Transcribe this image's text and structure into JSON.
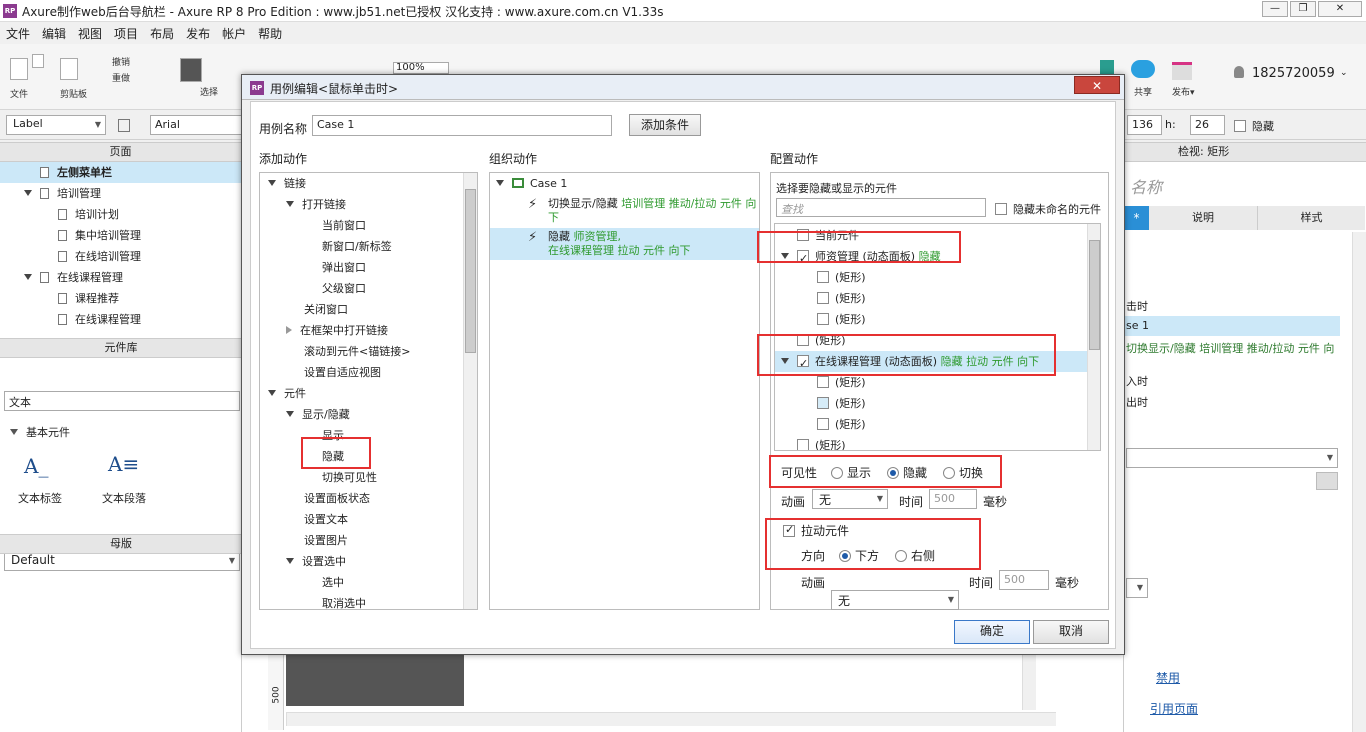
{
  "window": {
    "title": "Axure制作web后台导航栏 - Axure RP 8 Pro Edition : www.jb51.net已授权 汉化支持 : www.axure.com.cn V1.33s",
    "icon_text": "RP"
  },
  "menu": [
    "文件",
    "编辑",
    "视图",
    "项目",
    "布局",
    "发布",
    "帐户",
    "帮助"
  ],
  "toolbar": {
    "file_label": "文件",
    "clipboard_label": "剪贴板",
    "undo": "撤销",
    "redo": "重做",
    "select_label": "选择",
    "zoom": "100%",
    "share_label": "共享",
    "publish_label": "发布▾",
    "user": "1825720059"
  },
  "propbar": {
    "widget_type": "Label",
    "font": "Arial",
    "w_value": "136",
    "h_label": "h:",
    "h_value": "26",
    "hide_label": "隐藏"
  },
  "pages": {
    "header": "页面",
    "items": [
      {
        "label": "左侧菜单栏",
        "level": 1,
        "selected": true
      },
      {
        "label": "培训管理",
        "level": 1,
        "expand": true
      },
      {
        "label": "培训计划",
        "level": 2
      },
      {
        "label": "集中培训管理",
        "level": 2
      },
      {
        "label": "在线培训管理",
        "level": 2
      },
      {
        "label": "在线课程管理",
        "level": 1,
        "expand": true
      },
      {
        "label": "课程推荐",
        "level": 2
      },
      {
        "label": "在线课程管理",
        "level": 2
      }
    ]
  },
  "library": {
    "header": "元件库",
    "selected": "Default",
    "search": "文本",
    "group": "基本元件",
    "widgets": [
      "文本标签",
      "文本段落"
    ]
  },
  "masters": {
    "header": "母版"
  },
  "inspector": {
    "header": "检视: 矩形",
    "name_placeholder": "名称",
    "tabs": [
      "*",
      "说明",
      "样式"
    ],
    "events": [
      "击时",
      "se 1",
      "切换显示/隐藏 培训管理 推动/拉动 元件 向",
      "入时",
      "出时"
    ],
    "disable_link": "禁用",
    "ref_link": "引用页面"
  },
  "canvas": {
    "ruler_mark": "500"
  },
  "dialog": {
    "title": "用例编辑<鼠标单击时>",
    "case_name_label": "用例名称",
    "case_name_value": "Case 1",
    "add_condition": "添加条件",
    "col1_title": "添加动作",
    "col2_title": "组织动作",
    "col3_title": "配置动作",
    "actions_tree": [
      {
        "label": "链接",
        "indent": 0,
        "arrow": "down"
      },
      {
        "label": "打开链接",
        "indent": 1,
        "arrow": "down"
      },
      {
        "label": "当前窗口",
        "indent": 2
      },
      {
        "label": "新窗口/新标签",
        "indent": 2
      },
      {
        "label": "弹出窗口",
        "indent": 2
      },
      {
        "label": "父级窗口",
        "indent": 2
      },
      {
        "label": "关闭窗口",
        "indent": 1
      },
      {
        "label": "在框架中打开链接",
        "indent": 1,
        "arrow": "right"
      },
      {
        "label": "滚动到元件<锚链接>",
        "indent": 1
      },
      {
        "label": "设置自适应视图",
        "indent": 1
      },
      {
        "label": "元件",
        "indent": 0,
        "arrow": "down"
      },
      {
        "label": "显示/隐藏",
        "indent": 1,
        "arrow": "down"
      },
      {
        "label": "显示",
        "indent": 2
      },
      {
        "label": "隐藏",
        "indent": 2
      },
      {
        "label": "切换可见性",
        "indent": 2
      },
      {
        "label": "设置面板状态",
        "indent": 1
      },
      {
        "label": "设置文本",
        "indent": 1
      },
      {
        "label": "设置图片",
        "indent": 1
      },
      {
        "label": "设置选中",
        "indent": 1,
        "arrow": "down"
      },
      {
        "label": "选中",
        "indent": 2
      },
      {
        "label": "取消选中",
        "indent": 2
      }
    ],
    "case_label": "Case 1",
    "org_actions": [
      {
        "prefix": "切换显示/隐藏 ",
        "detail": "培训管理 推动/拉动 元件 向",
        "detail2": "下"
      },
      {
        "prefix": "隐藏 ",
        "detail": "师资管理,",
        "detail2": "在线课程管理 拉动 元件 向下"
      }
    ],
    "config": {
      "select_label": "选择要隐藏或显示的元件",
      "search_placeholder": "查找",
      "hide_unnamed": "隐藏未命名的元件",
      "widgets": [
        {
          "label": "当前元件",
          "indent": 1,
          "checked": false
        },
        {
          "label": "师资管理 (动态面板)",
          "extra": " 隐藏",
          "indent": 0,
          "checked": true,
          "arrow": true
        },
        {
          "label": "(矩形)",
          "indent": 2,
          "checked": false
        },
        {
          "label": "(矩形)",
          "indent": 2,
          "checked": false
        },
        {
          "label": "(矩形)",
          "indent": 2,
          "checked": false
        },
        {
          "label": "(矩形)",
          "indent": 1,
          "checked": false
        },
        {
          "label": "在线课程管理 (动态面板)",
          "extra": " 隐藏 拉动 元件 向下",
          "indent": 0,
          "checked": true,
          "arrow": true,
          "selected": true
        },
        {
          "label": "(矩形)",
          "indent": 2,
          "checked": false
        },
        {
          "label": "(矩形)",
          "indent": 2,
          "checked": false,
          "blue": true
        },
        {
          "label": "(矩形)",
          "indent": 2,
          "checked": false
        },
        {
          "label": "(矩形)",
          "indent": 1,
          "checked": false
        }
      ],
      "visibility_label": "可见性",
      "vis_show": "显示",
      "vis_hide": "隐藏",
      "vis_toggle": "切换",
      "anim_label": "动画",
      "anim_value": "无",
      "time_label": "时间",
      "time_value": "500",
      "ms_label": "毫秒",
      "pull_label": "拉动元件",
      "dir_label": "方向",
      "dir_down": "下方",
      "dir_right": "右侧",
      "anim2_label": "动画",
      "anim2_value": "无",
      "time2_label": "时间",
      "time2_value": "500",
      "ms2_label": "毫秒"
    },
    "ok": "确定",
    "cancel": "取消",
    "close": "✕"
  },
  "colors": {
    "accent_red": "#e53030",
    "green_text": "#2e9a2e",
    "selection": "#cce8f8"
  }
}
